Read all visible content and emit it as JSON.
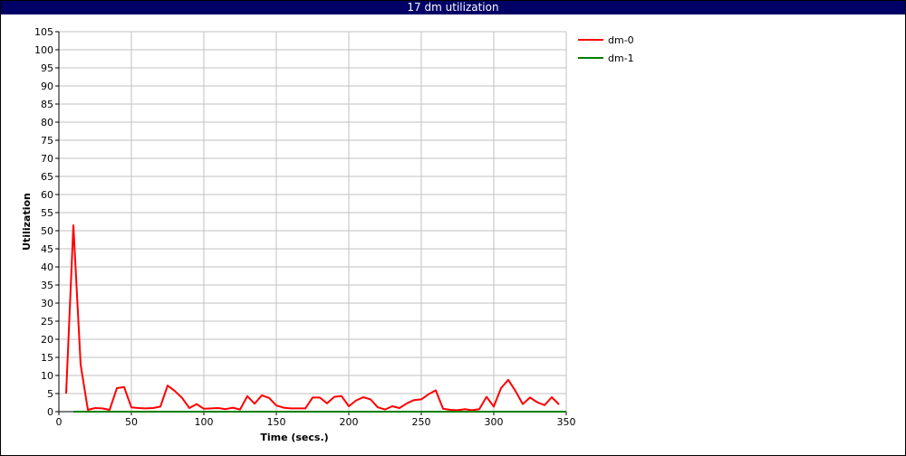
{
  "window": {
    "title": "17 dm utilization"
  },
  "colors": {
    "titlebar": "#000066",
    "grid": "#c0c0c0",
    "dm0": "#ff0000",
    "dm1": "#008000"
  },
  "chart_data": {
    "type": "line",
    "title": "17 dm utilization",
    "xlabel": "Time (secs.)",
    "ylabel": "Utilization",
    "xlim": [
      0,
      350
    ],
    "ylim": [
      0,
      105
    ],
    "xticks": [
      0,
      50,
      100,
      150,
      200,
      250,
      300,
      350
    ],
    "yticks": [
      0,
      5,
      10,
      15,
      20,
      25,
      30,
      35,
      40,
      45,
      50,
      55,
      60,
      65,
      70,
      75,
      80,
      85,
      90,
      95,
      100,
      105
    ],
    "grid": true,
    "legend_position": "top-right",
    "series": [
      {
        "name": "dm-0",
        "color": "#ff0000",
        "x": [
          5,
          10,
          15,
          20,
          25,
          30,
          35,
          40,
          45,
          50,
          55,
          60,
          65,
          70,
          75,
          80,
          85,
          90,
          95,
          100,
          105,
          110,
          115,
          120,
          125,
          130,
          135,
          140,
          145,
          150,
          155,
          160,
          165,
          170,
          175,
          180,
          185,
          190,
          195,
          200,
          205,
          210,
          215,
          220,
          225,
          230,
          235,
          240,
          245,
          250,
          255,
          260,
          265,
          270,
          275,
          280,
          285,
          290,
          295,
          300,
          305,
          310,
          315,
          320,
          325,
          330,
          335,
          340,
          345
        ],
        "y": [
          5,
          51.5,
          13,
          0.5,
          1,
          0.9,
          0.5,
          6.5,
          6.8,
          1.2,
          1,
          0.9,
          1,
          1.4,
          7.2,
          5.7,
          3.8,
          1,
          2.1,
          0.8,
          0.9,
          1,
          0.7,
          1.1,
          0.6,
          4.3,
          2.2,
          4.5,
          3.8,
          1.7,
          1.1,
          0.9,
          0.9,
          0.9,
          3.9,
          3.9,
          2.3,
          4.1,
          4.3,
          1.5,
          3.1,
          4,
          3.4,
          1.2,
          0.6,
          1.5,
          1,
          2.3,
          3.2,
          3.4,
          4.8,
          5.9,
          0.8,
          0.5,
          0.4,
          0.7,
          0.4,
          0.7,
          4.1,
          1.4,
          6.5,
          8.8,
          5.7,
          2.1,
          3.9,
          2.6,
          1.8,
          4,
          2
        ]
      },
      {
        "name": "dm-1",
        "color": "#008000",
        "x": [
          10,
          350
        ],
        "y": [
          0,
          0
        ]
      }
    ]
  }
}
